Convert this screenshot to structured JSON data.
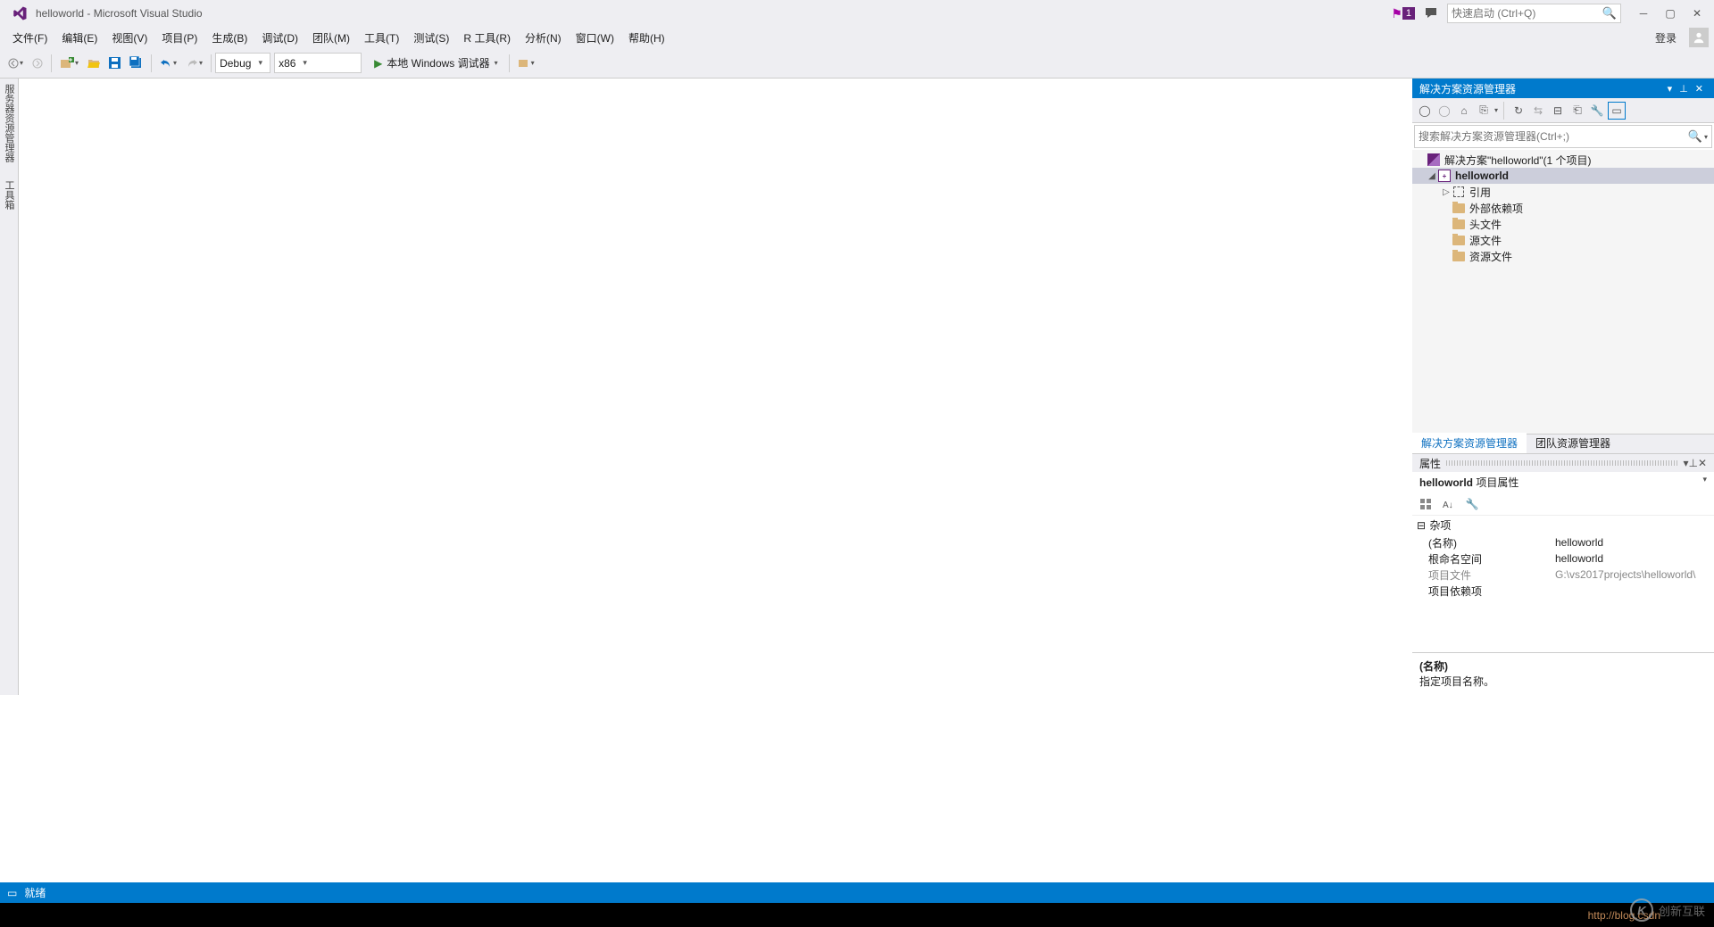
{
  "title": "helloworld - Microsoft Visual Studio",
  "quickLaunch": {
    "placeholder": "快速启动 (Ctrl+Q)"
  },
  "notificationCount": "1",
  "menu": {
    "file": "文件(F)",
    "edit": "编辑(E)",
    "view": "视图(V)",
    "project": "项目(P)",
    "build": "生成(B)",
    "debug": "调试(D)",
    "team": "团队(M)",
    "tools": "工具(T)",
    "test": "测试(S)",
    "rtools": "R 工具(R)",
    "analyze": "分析(N)",
    "window": "窗口(W)",
    "help": "帮助(H)",
    "signin": "登录"
  },
  "toolbar": {
    "configuration": "Debug",
    "platform": "x86",
    "debugger": "本地 Windows 调试器"
  },
  "leftTabs": {
    "serverExplorer": "服务器资源管理器",
    "toolbox": "工具箱"
  },
  "solutionExplorer": {
    "title": "解决方案资源管理器",
    "searchPlaceholder": "搜索解决方案资源管理器(Ctrl+;)",
    "solutionLabel": "解决方案\"helloworld\"(1 个项目)",
    "project": "helloworld",
    "refs": "引用",
    "external": "外部依赖项",
    "headers": "头文件",
    "sources": "源文件",
    "resources": "资源文件",
    "tabActive": "解决方案资源管理器",
    "tabTeam": "团队资源管理器"
  },
  "properties": {
    "title": "属性",
    "object": "helloworld",
    "objectType": "项目属性",
    "category": "杂项",
    "rows": {
      "nameKey": "(名称)",
      "nameVal": "helloworld",
      "nsKey": "根命名空间",
      "nsVal": "helloworld",
      "fileKey": "项目文件",
      "fileVal": "G:\\vs2017projects\\helloworld\\",
      "depKey": "项目依赖项",
      "depVal": ""
    },
    "descTitle": "(名称)",
    "descText": "指定项目名称。"
  },
  "status": {
    "ready": "就绪"
  },
  "watermark": {
    "url": "http://blog.csdn",
    "brand": "创新互联"
  }
}
